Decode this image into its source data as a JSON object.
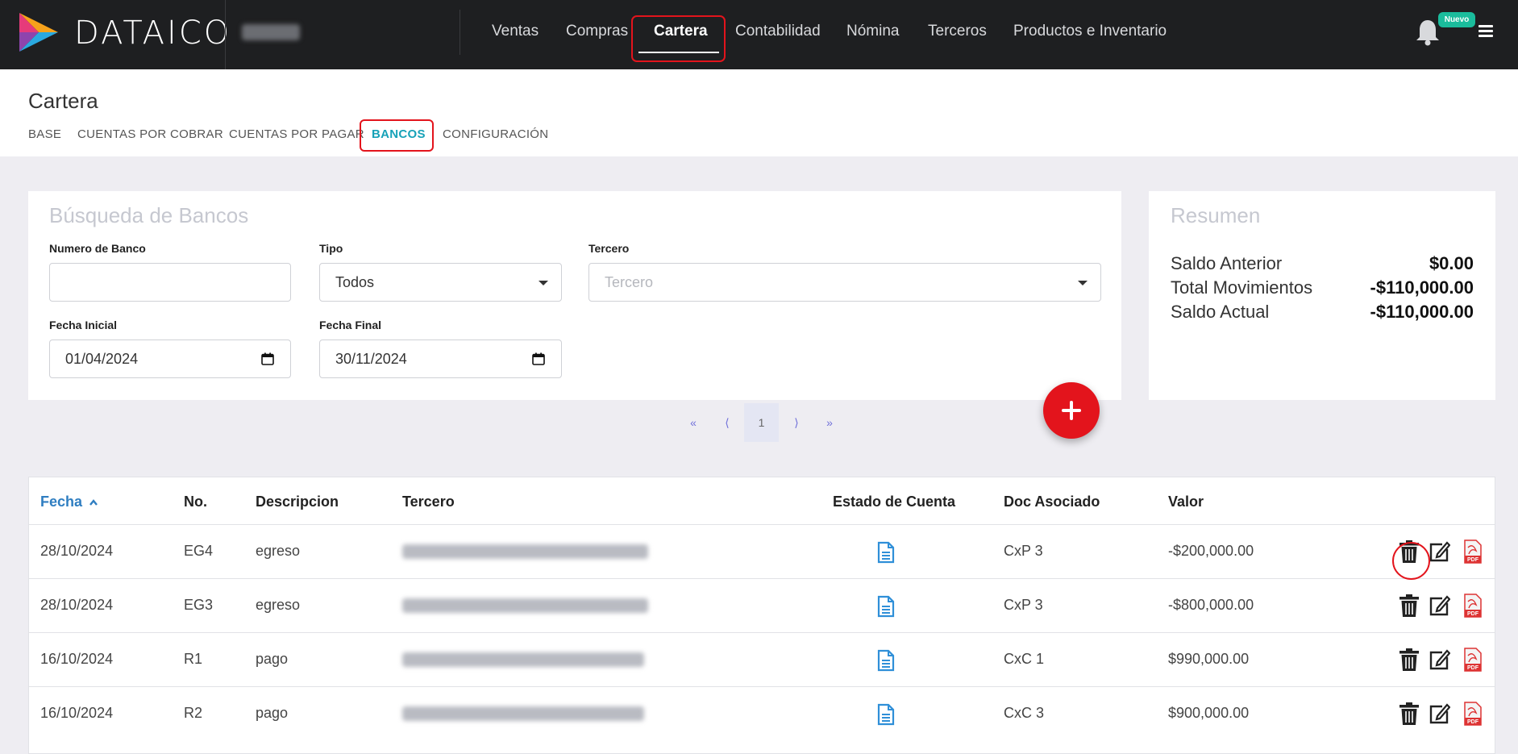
{
  "brand": "DATAICO",
  "nav": {
    "items": [
      "Ventas",
      "Compras",
      "Cartera",
      "Contabilidad",
      "Nómina",
      "Terceros",
      "Productos e Inventario"
    ],
    "active": "Cartera"
  },
  "notifications": {
    "badge": "Nuevo"
  },
  "page": {
    "title": "Cartera",
    "tabs": [
      "BASE",
      "CUENTAS POR COBRAR",
      "CUENTAS POR PAGAR",
      "BANCOS",
      "CONFIGURACIÓN"
    ],
    "active_tab": "BANCOS"
  },
  "search": {
    "title": "Búsqueda de Bancos",
    "numero_label": "Numero de Banco",
    "numero_value": "",
    "tipo_label": "Tipo",
    "tipo_value": "Todos",
    "tercero_label": "Tercero",
    "tercero_placeholder": "Tercero",
    "fecha_inicial_label": "Fecha Inicial",
    "fecha_inicial_value": "01/04/2024",
    "fecha_final_label": "Fecha Final",
    "fecha_final_value": "30/11/2024"
  },
  "summary": {
    "title": "Resumen",
    "items": [
      {
        "label": "Saldo Anterior",
        "value": "$0.00"
      },
      {
        "label": "Total Movimientos",
        "value": "-$110,000.00"
      },
      {
        "label": "Saldo Actual",
        "value": "-$110,000.00"
      }
    ]
  },
  "pagination": {
    "first": "«",
    "prev": "⟨",
    "current": "1",
    "next": "⟩",
    "last": "»"
  },
  "table": {
    "headers": [
      "Fecha",
      "No.",
      "Descripcion",
      "Tercero",
      "Estado de Cuenta",
      "Doc Asociado",
      "Valor"
    ],
    "rows": [
      {
        "fecha": "28/10/2024",
        "no": "EG4",
        "descripcion": "egreso",
        "doc": "CxP 3",
        "valor": "-$200,000.00"
      },
      {
        "fecha": "28/10/2024",
        "no": "EG3",
        "descripcion": "egreso",
        "doc": "CxP 3",
        "valor": "-$800,000.00"
      },
      {
        "fecha": "16/10/2024",
        "no": "R1",
        "descripcion": "pago",
        "doc": "CxC 1",
        "valor": "$990,000.00"
      },
      {
        "fecha": "16/10/2024",
        "no": "R2",
        "descripcion": "pago",
        "doc": "CxC 3",
        "valor": "$900,000.00"
      }
    ]
  },
  "colors": {
    "accent_red": "#e3141c",
    "teal": "#17a2b8",
    "link_blue": "#2f7ec1",
    "topbar": "#1e1f21"
  },
  "icons": [
    "logo-icon",
    "bell-icon",
    "menu-icon",
    "chevron-down-icon",
    "calendar-icon",
    "plus-icon",
    "sort-up-icon",
    "document-icon",
    "trash-icon",
    "edit-icon",
    "pdf-icon"
  ]
}
